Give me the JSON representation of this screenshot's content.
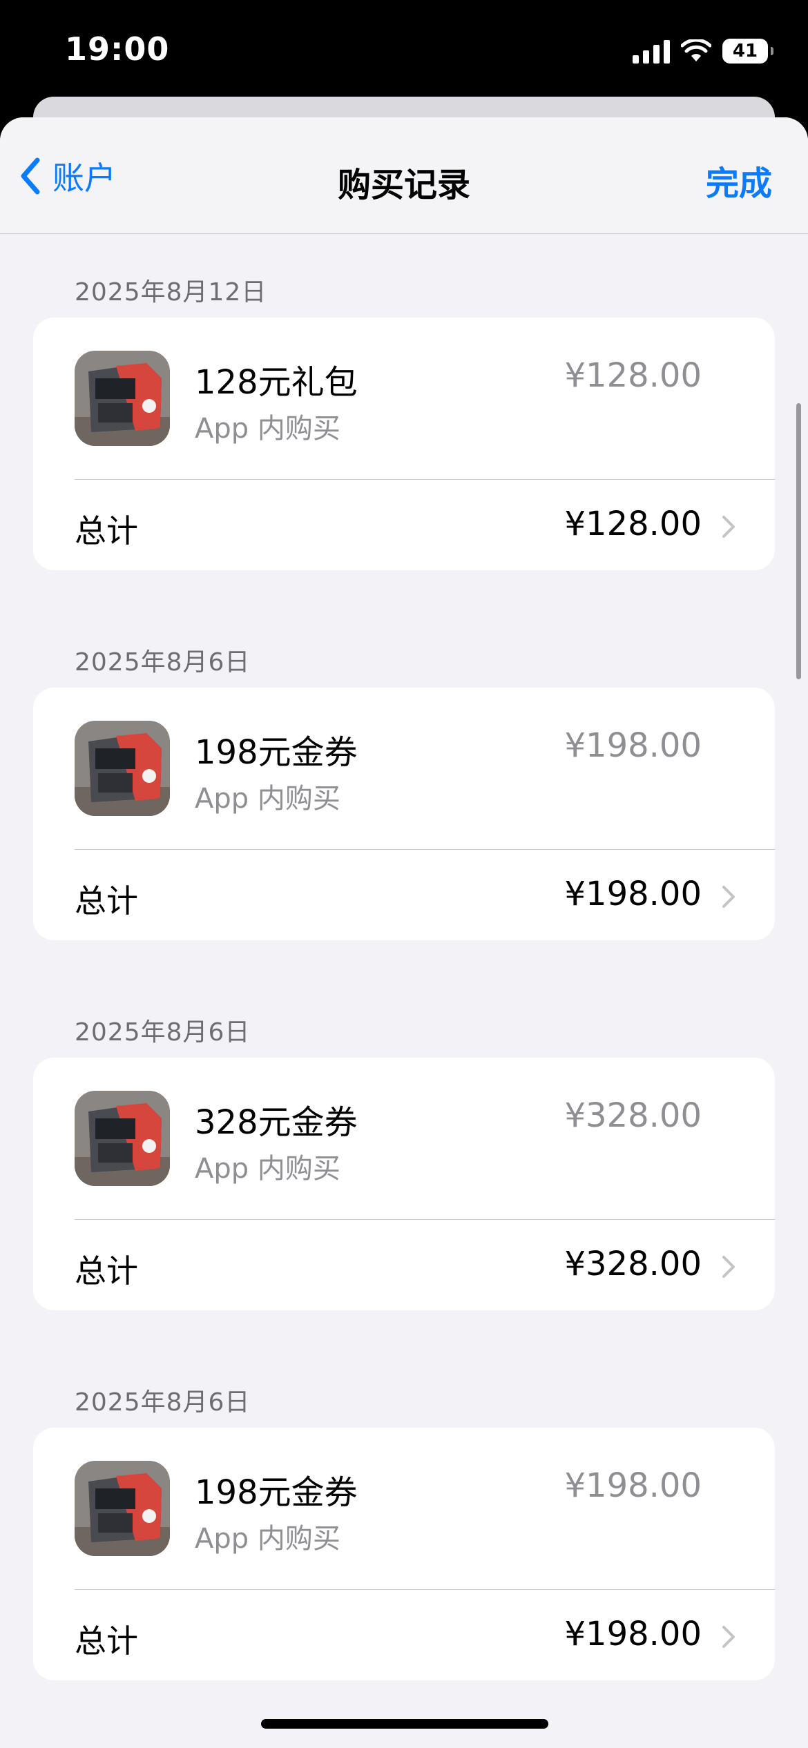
{
  "status_bar": {
    "time": "19:00",
    "battery": "41"
  },
  "nav": {
    "back_label": "账户",
    "title": "购买记录",
    "done_label": "完成"
  },
  "purchases": [
    {
      "date": "2025年8月12日",
      "item_name": "128元礼包",
      "item_type": "App 内购买",
      "price": "¥128.00",
      "total_label": "总计",
      "total": "¥128.00"
    },
    {
      "date": "2025年8月6日",
      "item_name": "198元金券",
      "item_type": "App 内购买",
      "price": "¥198.00",
      "total_label": "总计",
      "total": "¥198.00"
    },
    {
      "date": "2025年8月6日",
      "item_name": "328元金券",
      "item_type": "App 内购买",
      "price": "¥328.00",
      "total_label": "总计",
      "total": "¥328.00"
    },
    {
      "date": "2025年8月6日",
      "item_name": "198元金券",
      "item_type": "App 内购买",
      "price": "¥198.00",
      "total_label": "总计",
      "total": "¥198.00"
    }
  ],
  "colors": {
    "accent": "#0a7aff",
    "background": "#f2f2f7",
    "secondary_text": "#8e8e93"
  },
  "icons": {
    "app_icon": "red-truck-app-icon",
    "back": "chevron-left-icon",
    "row_chevron": "chevron-right-icon"
  }
}
